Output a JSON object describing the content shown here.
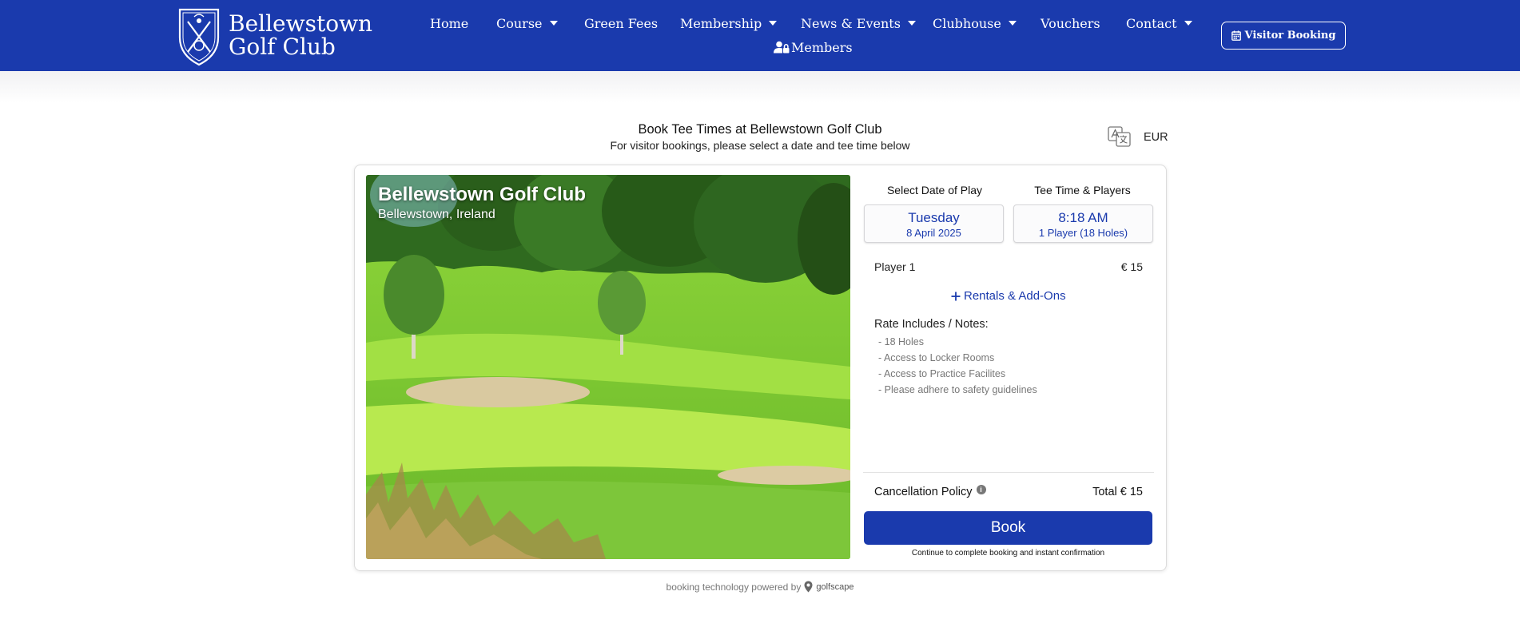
{
  "header": {
    "logo_line1": "Bellewstown",
    "logo_line2": "Golf Club",
    "nav": [
      "Home",
      "Course",
      "Green Fees",
      "Membership",
      "News & Events",
      "Clubhouse",
      "Vouchers",
      "Contact"
    ],
    "members_label": "Members",
    "visitor_booking_label": "Visitor Booking",
    "brand_color": "#1a3aad"
  },
  "page": {
    "title": "Book Tee Times at Bellewstown Golf Club",
    "subtitle": "For visitor bookings, please select a date and tee time below",
    "currency": "EUR"
  },
  "course": {
    "name": "Bellewstown Golf Club",
    "location": "Bellewstown, Ireland"
  },
  "booking": {
    "date_label": "Select Date of Play",
    "date_day": "Tuesday",
    "date_full": "8 April 2025",
    "time_label": "Tee Time & Players",
    "time_value": "8:18 AM",
    "players_value": "1 Player (18 Holes)",
    "player_label": "Player 1",
    "player_price": "€ 15",
    "rentals_label": "Rentals & Add-Ons",
    "notes_label": "Rate Includes / Notes:",
    "notes": [
      "- 18 Holes",
      "- Access to Locker Rooms",
      "- Access to Practice Facilites",
      "- Please adhere to safety guidelines"
    ],
    "cancellation_label": "Cancellation Policy",
    "total_label": "Total € 15",
    "book_label": "Book",
    "continue_text": "Continue to complete booking and instant confirmation"
  },
  "footer": {
    "powered_text": "booking technology powered by",
    "brand_name": "golfscape"
  }
}
